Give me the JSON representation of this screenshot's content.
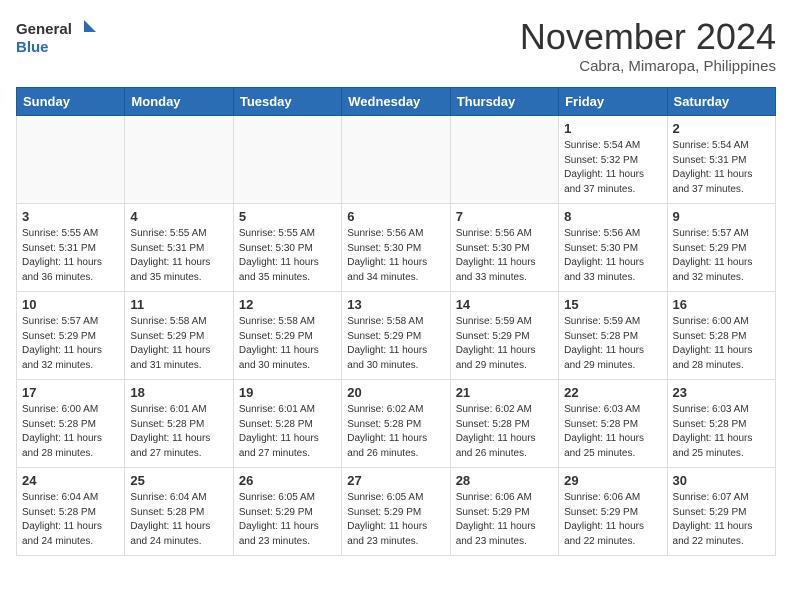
{
  "header": {
    "logo_line1": "General",
    "logo_line2": "Blue",
    "month": "November 2024",
    "location": "Cabra, Mimaropa, Philippines"
  },
  "weekdays": [
    "Sunday",
    "Monday",
    "Tuesday",
    "Wednesday",
    "Thursday",
    "Friday",
    "Saturday"
  ],
  "weeks": [
    [
      {
        "day": "",
        "info": ""
      },
      {
        "day": "",
        "info": ""
      },
      {
        "day": "",
        "info": ""
      },
      {
        "day": "",
        "info": ""
      },
      {
        "day": "",
        "info": ""
      },
      {
        "day": "1",
        "info": "Sunrise: 5:54 AM\nSunset: 5:32 PM\nDaylight: 11 hours\nand 37 minutes."
      },
      {
        "day": "2",
        "info": "Sunrise: 5:54 AM\nSunset: 5:31 PM\nDaylight: 11 hours\nand 37 minutes."
      }
    ],
    [
      {
        "day": "3",
        "info": "Sunrise: 5:55 AM\nSunset: 5:31 PM\nDaylight: 11 hours\nand 36 minutes."
      },
      {
        "day": "4",
        "info": "Sunrise: 5:55 AM\nSunset: 5:31 PM\nDaylight: 11 hours\nand 35 minutes."
      },
      {
        "day": "5",
        "info": "Sunrise: 5:55 AM\nSunset: 5:30 PM\nDaylight: 11 hours\nand 35 minutes."
      },
      {
        "day": "6",
        "info": "Sunrise: 5:56 AM\nSunset: 5:30 PM\nDaylight: 11 hours\nand 34 minutes."
      },
      {
        "day": "7",
        "info": "Sunrise: 5:56 AM\nSunset: 5:30 PM\nDaylight: 11 hours\nand 33 minutes."
      },
      {
        "day": "8",
        "info": "Sunrise: 5:56 AM\nSunset: 5:30 PM\nDaylight: 11 hours\nand 33 minutes."
      },
      {
        "day": "9",
        "info": "Sunrise: 5:57 AM\nSunset: 5:29 PM\nDaylight: 11 hours\nand 32 minutes."
      }
    ],
    [
      {
        "day": "10",
        "info": "Sunrise: 5:57 AM\nSunset: 5:29 PM\nDaylight: 11 hours\nand 32 minutes."
      },
      {
        "day": "11",
        "info": "Sunrise: 5:58 AM\nSunset: 5:29 PM\nDaylight: 11 hours\nand 31 minutes."
      },
      {
        "day": "12",
        "info": "Sunrise: 5:58 AM\nSunset: 5:29 PM\nDaylight: 11 hours\nand 30 minutes."
      },
      {
        "day": "13",
        "info": "Sunrise: 5:58 AM\nSunset: 5:29 PM\nDaylight: 11 hours\nand 30 minutes."
      },
      {
        "day": "14",
        "info": "Sunrise: 5:59 AM\nSunset: 5:29 PM\nDaylight: 11 hours\nand 29 minutes."
      },
      {
        "day": "15",
        "info": "Sunrise: 5:59 AM\nSunset: 5:28 PM\nDaylight: 11 hours\nand 29 minutes."
      },
      {
        "day": "16",
        "info": "Sunrise: 6:00 AM\nSunset: 5:28 PM\nDaylight: 11 hours\nand 28 minutes."
      }
    ],
    [
      {
        "day": "17",
        "info": "Sunrise: 6:00 AM\nSunset: 5:28 PM\nDaylight: 11 hours\nand 28 minutes."
      },
      {
        "day": "18",
        "info": "Sunrise: 6:01 AM\nSunset: 5:28 PM\nDaylight: 11 hours\nand 27 minutes."
      },
      {
        "day": "19",
        "info": "Sunrise: 6:01 AM\nSunset: 5:28 PM\nDaylight: 11 hours\nand 27 minutes."
      },
      {
        "day": "20",
        "info": "Sunrise: 6:02 AM\nSunset: 5:28 PM\nDaylight: 11 hours\nand 26 minutes."
      },
      {
        "day": "21",
        "info": "Sunrise: 6:02 AM\nSunset: 5:28 PM\nDaylight: 11 hours\nand 26 minutes."
      },
      {
        "day": "22",
        "info": "Sunrise: 6:03 AM\nSunset: 5:28 PM\nDaylight: 11 hours\nand 25 minutes."
      },
      {
        "day": "23",
        "info": "Sunrise: 6:03 AM\nSunset: 5:28 PM\nDaylight: 11 hours\nand 25 minutes."
      }
    ],
    [
      {
        "day": "24",
        "info": "Sunrise: 6:04 AM\nSunset: 5:28 PM\nDaylight: 11 hours\nand 24 minutes."
      },
      {
        "day": "25",
        "info": "Sunrise: 6:04 AM\nSunset: 5:28 PM\nDaylight: 11 hours\nand 24 minutes."
      },
      {
        "day": "26",
        "info": "Sunrise: 6:05 AM\nSunset: 5:29 PM\nDaylight: 11 hours\nand 23 minutes."
      },
      {
        "day": "27",
        "info": "Sunrise: 6:05 AM\nSunset: 5:29 PM\nDaylight: 11 hours\nand 23 minutes."
      },
      {
        "day": "28",
        "info": "Sunrise: 6:06 AM\nSunset: 5:29 PM\nDaylight: 11 hours\nand 23 minutes."
      },
      {
        "day": "29",
        "info": "Sunrise: 6:06 AM\nSunset: 5:29 PM\nDaylight: 11 hours\nand 22 minutes."
      },
      {
        "day": "30",
        "info": "Sunrise: 6:07 AM\nSunset: 5:29 PM\nDaylight: 11 hours\nand 22 minutes."
      }
    ]
  ]
}
